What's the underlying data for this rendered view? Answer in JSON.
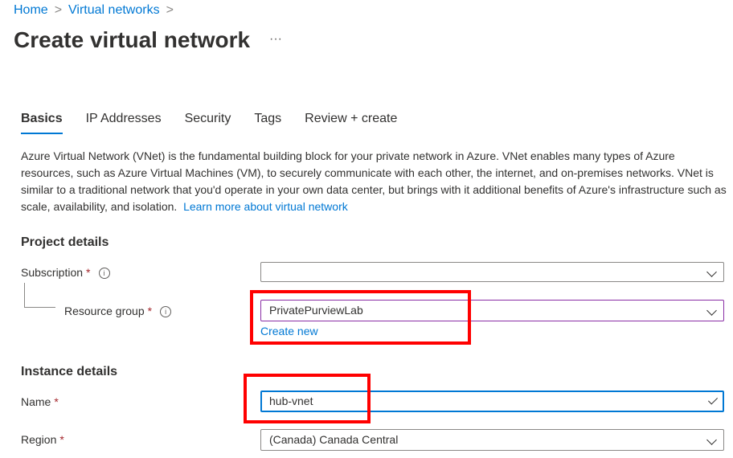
{
  "breadcrumb": [
    {
      "label": "Home"
    },
    {
      "label": "Virtual networks"
    }
  ],
  "page_title": "Create virtual network",
  "more_label": "···",
  "tabs": [
    {
      "label": "Basics",
      "active": true
    },
    {
      "label": "IP Addresses"
    },
    {
      "label": "Security"
    },
    {
      "label": "Tags"
    },
    {
      "label": "Review + create"
    }
  ],
  "description": "Azure Virtual Network (VNet) is the fundamental building block for your private network in Azure. VNet enables many types of Azure resources, such as Azure Virtual Machines (VM), to securely communicate with each other, the internet, and on-premises networks. VNet is similar to a traditional network that you'd operate in your own data center, but brings with it additional benefits of Azure's infrastructure such as scale, availability, and isolation.",
  "learn_more": "Learn more about virtual network",
  "project_details": {
    "heading": "Project details",
    "subscription": {
      "label": "Subscription",
      "required": "*",
      "value": ""
    },
    "resource_group": {
      "label": "Resource group",
      "required": "*",
      "value": "PrivatePurviewLab",
      "create_new": "Create new"
    }
  },
  "instance_details": {
    "heading": "Instance details",
    "name": {
      "label": "Name",
      "required": "*",
      "value": "hub-vnet"
    },
    "region": {
      "label": "Region",
      "required": "*",
      "value": "(Canada) Canada Central"
    }
  },
  "info_glyph": "i",
  "colors": {
    "accent": "#0078d4",
    "highlight": "#ff0000",
    "focus_purple": "#8a2da5"
  }
}
